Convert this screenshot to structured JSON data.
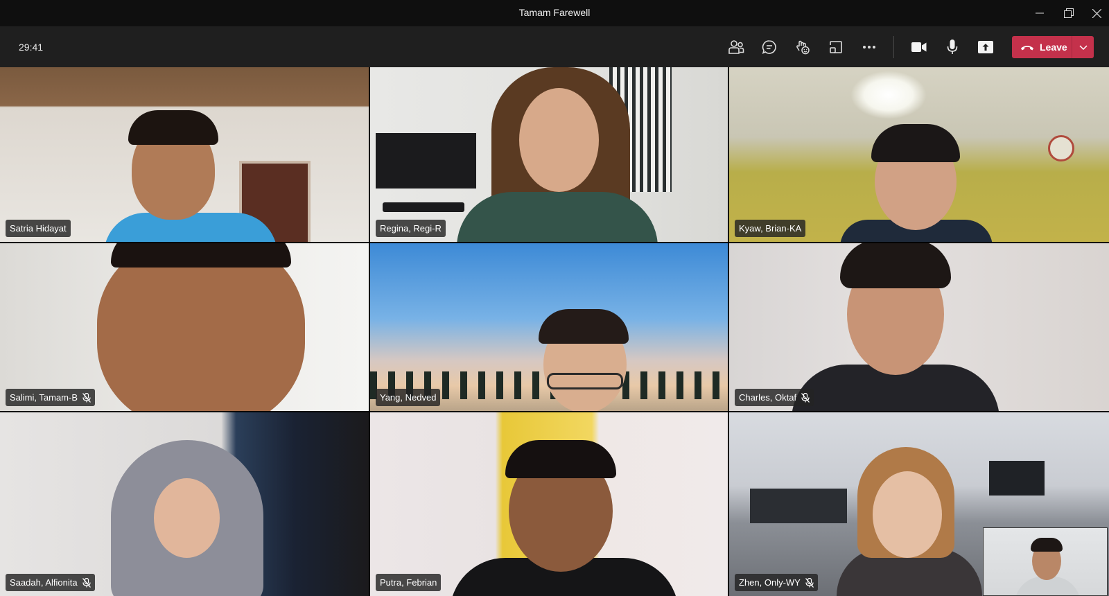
{
  "window": {
    "title": "Tamam Farewell"
  },
  "toolbar": {
    "timer": "29:41",
    "leave_label": "Leave",
    "icons": [
      "people-icon",
      "chat-icon",
      "reactions-icon",
      "share-tray-icon",
      "more-icon",
      "camera-icon",
      "mic-icon",
      "share-screen-icon",
      "phone-hangup-icon",
      "chevron-down-icon"
    ]
  },
  "colors": {
    "leave": "#c4314b",
    "titlebar": "#0f0f0f",
    "toolbar": "#1f1f1f"
  },
  "participants": [
    {
      "name": "Satria Hidayat",
      "muted": false
    },
    {
      "name": "Regina, Regi-R",
      "muted": false
    },
    {
      "name": "Kyaw, Brian-KA",
      "muted": false
    },
    {
      "name": "Salimi, Tamam-B",
      "muted": true
    },
    {
      "name": "Yang, Nedved",
      "muted": false
    },
    {
      "name": "Charles, Oktaf",
      "muted": true
    },
    {
      "name": "Saadah, Alfionita",
      "muted": true
    },
    {
      "name": "Putra, Febrian",
      "muted": false
    },
    {
      "name": "Zhen, Only-WY",
      "muted": true
    }
  ]
}
